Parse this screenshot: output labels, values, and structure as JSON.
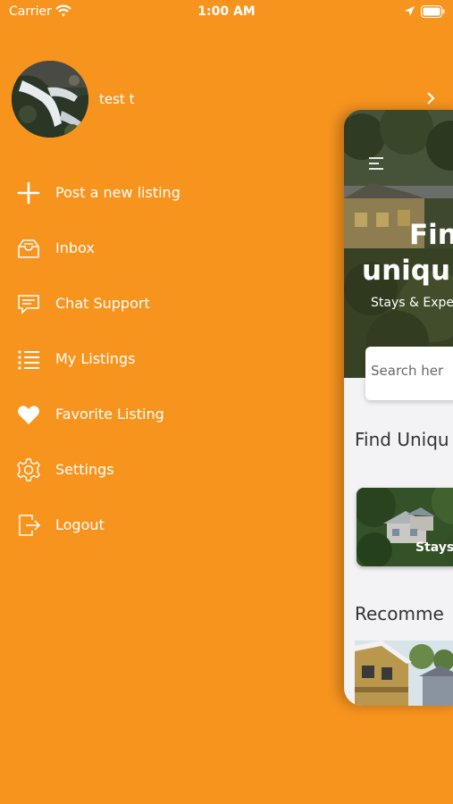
{
  "status_bar": {
    "carrier": "Carrier",
    "time": "1:00 AM"
  },
  "profile": {
    "name": "test t",
    "avatar_icon": "waterfall-photo"
  },
  "menu": {
    "items": [
      {
        "label": "Post a new listing",
        "icon": "plus-icon"
      },
      {
        "label": "Inbox",
        "icon": "inbox-icon"
      },
      {
        "label": "Chat Support",
        "icon": "chat-icon"
      },
      {
        "label": "My Listings",
        "icon": "list-icon"
      },
      {
        "label": "Favorite Listing",
        "icon": "heart-icon"
      },
      {
        "label": "Settings",
        "icon": "gear-icon"
      },
      {
        "label": "Logout",
        "icon": "logout-icon"
      }
    ]
  },
  "preview": {
    "hero_title_line1": "Fin",
    "hero_title_line2": "uniqu",
    "hero_subtitle": "Stays & Expe",
    "search_placeholder": "Search her",
    "section_find": "Find Uniqu",
    "category_label": "Stays",
    "section_recommend": "Recomme"
  },
  "colors": {
    "background": "#F7941E",
    "text": "#FFFFFF",
    "card_background": "#F3F3F5"
  }
}
